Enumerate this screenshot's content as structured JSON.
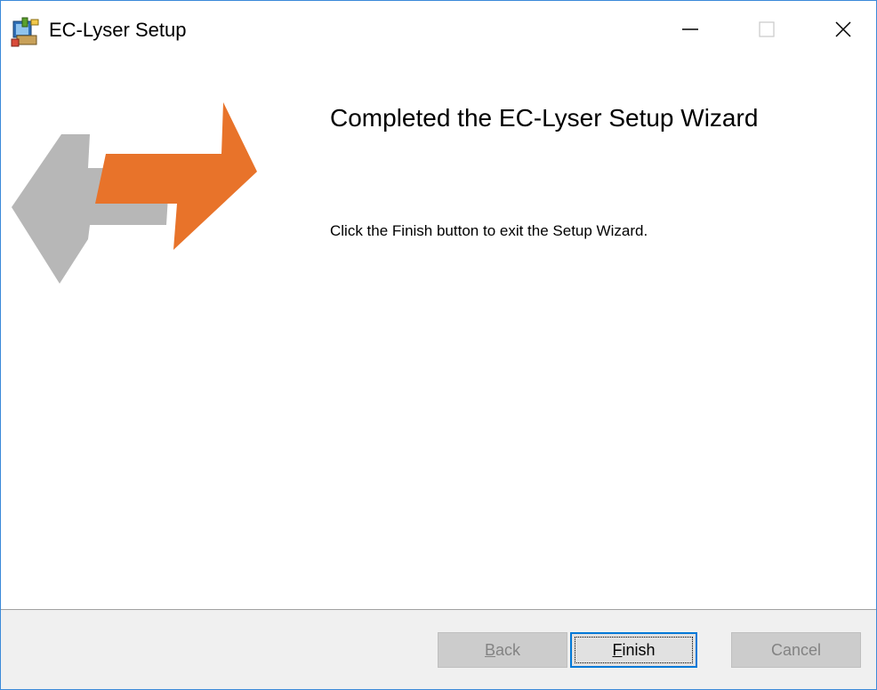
{
  "window": {
    "title": "EC-Lyser Setup",
    "app_icon": "installer-icon",
    "controls": {
      "minimize": "minimize-icon",
      "maximize": "maximize-icon",
      "close": "close-icon"
    }
  },
  "content": {
    "art": "swap-arrows-graphic",
    "heading": "Completed the EC-Lyser Setup Wizard",
    "message": "Click the Finish button to exit the Setup Wizard."
  },
  "buttons": {
    "back": {
      "mnemonic": "B",
      "rest": "ack",
      "enabled": false
    },
    "finish": {
      "mnemonic": "F",
      "rest": "inish",
      "enabled": true,
      "focused": true
    },
    "cancel": {
      "label": "Cancel",
      "enabled": false
    }
  },
  "colors": {
    "orange_arrow": "#e8732a",
    "gray_arrow": "#b7b7b7",
    "focus_border": "#0078d7",
    "window_border": "#3b8ad9"
  }
}
